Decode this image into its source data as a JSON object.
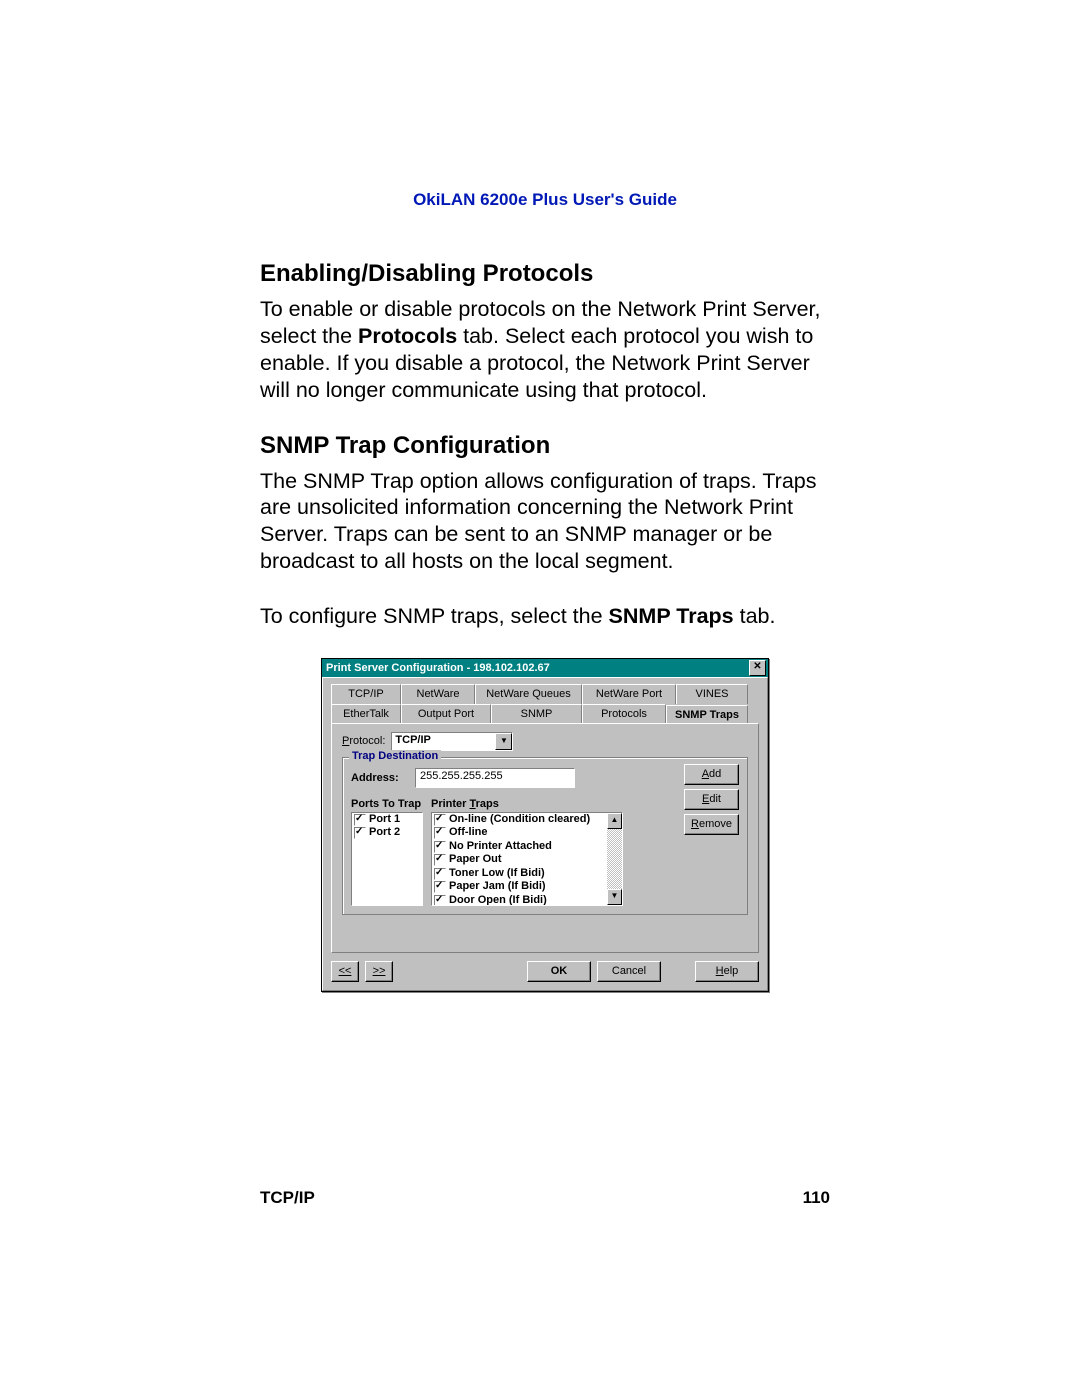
{
  "header": {
    "guide_title": "OkiLAN 6200e Plus User's Guide"
  },
  "section1": {
    "heading": "Enabling/Disabling Protocols",
    "para_pre": "To enable or disable protocols on the Network Print Server, select the ",
    "para_bold": "Protocols",
    "para_post": " tab. Select each protocol you wish to enable. If you disable a protocol, the Net­work Print Server will no longer communicate using that protocol."
  },
  "section2": {
    "heading": "SNMP Trap Configuration",
    "para1": "The SNMP Trap option allows configuration of traps. Traps are unsolicited information concerning the Net­work Print Server. Traps can be sent to an SNMP manager or be broadcast to all hosts on the local seg­ment.",
    "para2_pre": "To configure SNMP traps, select the ",
    "para2_bold": "SNMP Traps",
    "para2_post": " tab."
  },
  "dialog": {
    "title": "Print Server Configuration - 198.102.102.67",
    "tabs_row1": [
      "TCP/IP",
      "NetWare",
      "NetWare Queues",
      "NetWare Port",
      "VINES"
    ],
    "tabs_row2": [
      "EtherTalk",
      "Output Port",
      "SNMP",
      "Protocols",
      "SNMP Traps"
    ],
    "active_tab": "SNMP Traps",
    "protocol_label": "Protocol:",
    "protocol_value": "TCP/IP",
    "group_title": "Trap Destination",
    "address_label": "Address:",
    "address_value": "255.255.255.255",
    "ports_label": "Ports To Trap",
    "traps_label": "Printer Traps",
    "ports": [
      "Port 1",
      "Port 2"
    ],
    "printer_traps": [
      "On-line (Condition cleared)",
      "Off-line",
      "No Printer Attached",
      "Paper Out",
      "Toner Low (If Bidi)",
      "Paper Jam (If Bidi)",
      "Door Open (If Bidi)"
    ],
    "buttons": {
      "add": "Add",
      "edit": "Edit",
      "remove": "Remove"
    },
    "bottom": {
      "prev": "<<",
      "next": ">>",
      "ok": "OK",
      "cancel": "Cancel",
      "help": "Help"
    }
  },
  "footer": {
    "section": "TCP/IP",
    "page_num": "110"
  }
}
